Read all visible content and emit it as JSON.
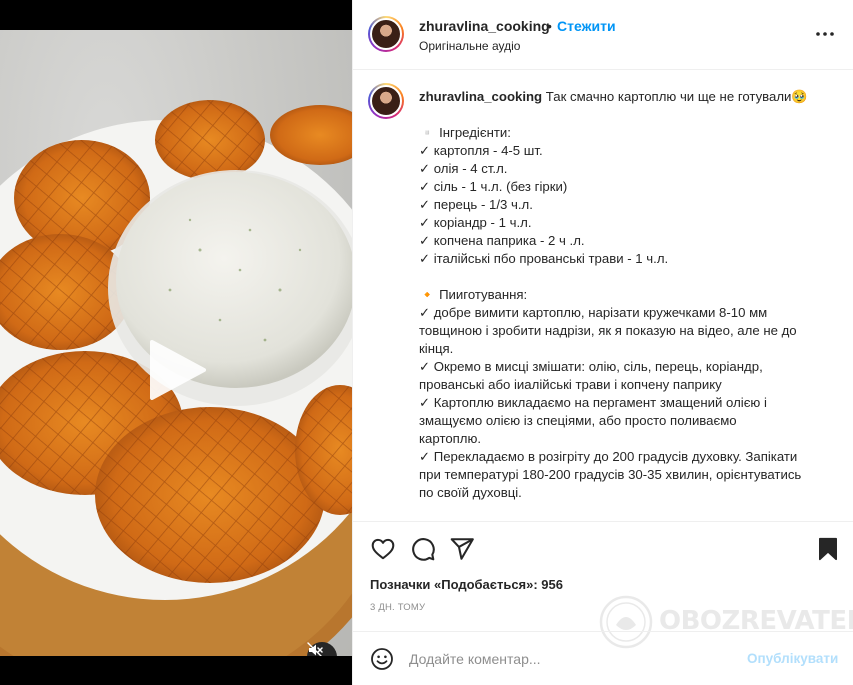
{
  "post": {
    "username": "zhuravlina_cooking",
    "separator": "•",
    "follow_label": "Стежити",
    "audio_label": "Оригінальне аудіо"
  },
  "caption": {
    "username": "zhuravlina_cooking",
    "first_line": "Так смачно картоплю чи ще не готували🥹",
    "lines": [
      "▫️ Інгредієнти:",
      "✓ картопля - 4-5 шт.",
      "✓ олія - 4 ст.л.",
      "✓ сіль - 1 ч.л. (без гірки)",
      "✓ перець - 1/3 ч.л.",
      "✓ коріандр - 1 ч.л.",
      "✓ копчена паприка - 2 ч .л.",
      "✓ італійські пбо прованські трави - 1 ч.л.",
      "",
      "🔸 Пииготування:",
      "✓ добре вимити картоплю, нарізати кружечками 8-10 мм",
      "товщиною і зробити надрізи, як я показую на відео, але не до",
      "кінця.",
      "✓ Окремо в мисці змішати: олію, сіль, перець, коріандр,",
      "прованські або іиалійські трави і копчену паприку",
      "✓ Картоплю викладаємо на пергамент змащений олією і",
      "змащуємо олією із спеціями, або просто поливаємо",
      "картоплю.",
      "✓ Перекладаємо в розігріту до 200 градусів духовку. Запікати",
      "при температурі 180-200 градусів 30-35 хвилин, орієнтуватись",
      "по своїй духовці."
    ]
  },
  "actions": {
    "likes_text": "Позначки «Подобається»: 956",
    "time_text": "3 ДН. ТОМУ"
  },
  "watermark": {
    "text": "OBOZREVATEL"
  },
  "composer": {
    "placeholder": "Додайте коментар...",
    "publish_label": "Опублікувати"
  },
  "icons": {
    "more": "more-options-icon",
    "like": "heart-icon",
    "comment": "comment-icon",
    "share": "share-icon",
    "save": "bookmark-icon",
    "emoji": "emoji-icon",
    "play": "play-icon",
    "mute": "mute-icon"
  },
  "colors": {
    "accent": "#0095f6",
    "publish_disabled": "#b2dffc",
    "muted_text": "#8e8e8e"
  }
}
